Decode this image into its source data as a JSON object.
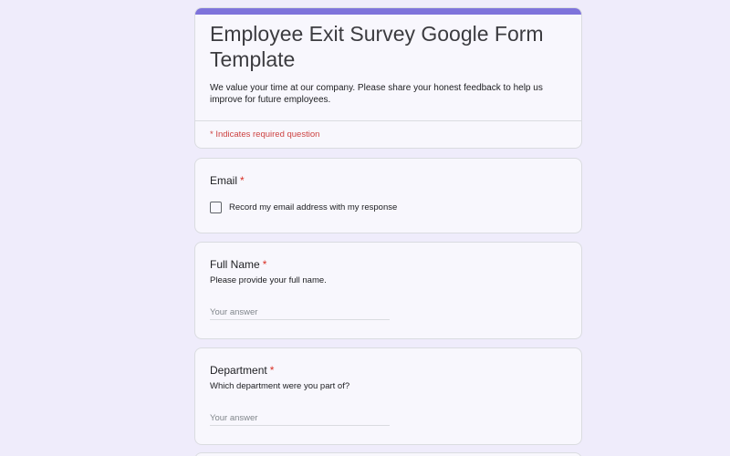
{
  "form": {
    "title": "Employee Exit Survey Google Form Template",
    "description": "We value your time at our company. Please share your honest feedback to help us improve for future employees.",
    "required_note": "* Indicates required question",
    "accent_color": "#7e73db",
    "background_color": "#efecfb"
  },
  "questions": {
    "email": {
      "title": "Email",
      "required_mark": "*",
      "checkbox_label": "Record my email address with my response",
      "checked": false
    },
    "full_name": {
      "title": "Full Name",
      "required_mark": "*",
      "description": "Please provide your full name.",
      "placeholder": "Your answer",
      "value": ""
    },
    "department": {
      "title": "Department",
      "required_mark": "*",
      "description": "Which department were you part of?",
      "placeholder": "Your answer",
      "value": ""
    }
  }
}
